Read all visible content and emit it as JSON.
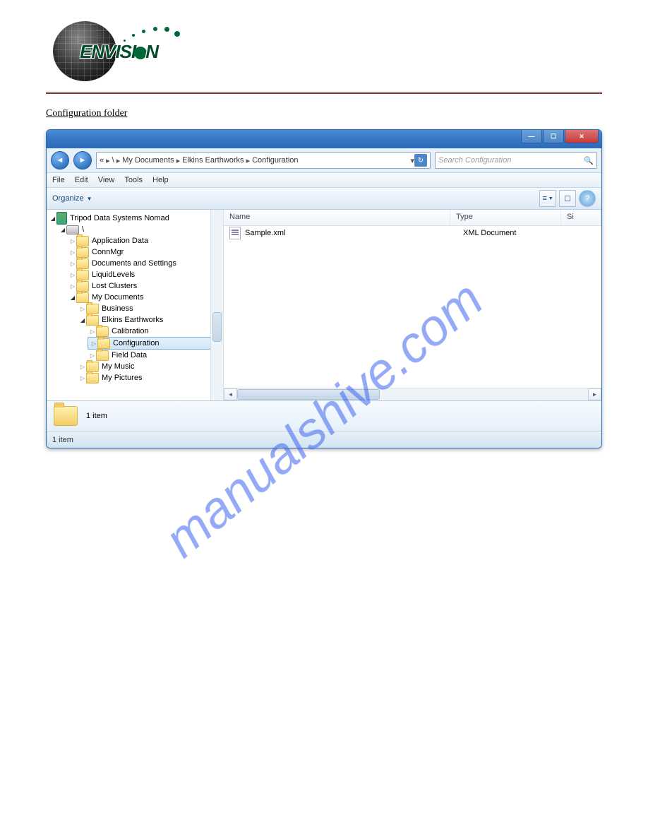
{
  "brand": "ENVISI N",
  "doc": {
    "section_title": "Configuration folder"
  },
  "window": {
    "breadcrumb": [
      "«",
      "\\",
      "My Documents",
      "Elkins Earthworks",
      "Configuration"
    ],
    "search_placeholder": "Search Configuration",
    "menus": [
      "File",
      "Edit",
      "View",
      "Tools",
      "Help"
    ],
    "organize": "Organize",
    "views_hint": "≡",
    "preview_hint": "☐",
    "help_hint": "?",
    "tree_root": "Tripod Data Systems Nomad",
    "tree_drive": "\\",
    "tree_nodes_top": [
      "Application Data",
      "ConnMgr",
      "Documents and Settings",
      "LiquidLevels",
      "Lost Clusters"
    ],
    "tree_mydocs": "My Documents",
    "tree_business": "Business",
    "tree_elkins": "Elkins Earthworks",
    "tree_elkins_children": [
      "Calibration",
      "Configuration",
      "Field Data"
    ],
    "tree_mydocs_tail": [
      "My Music",
      "My Pictures"
    ],
    "col_name": "Name",
    "col_type": "Type",
    "col_size": "Si",
    "file_name": "Sample.xml",
    "file_type": "XML Document",
    "detail": "1 item",
    "status": "1 item"
  },
  "watermark": "manualshive.com"
}
